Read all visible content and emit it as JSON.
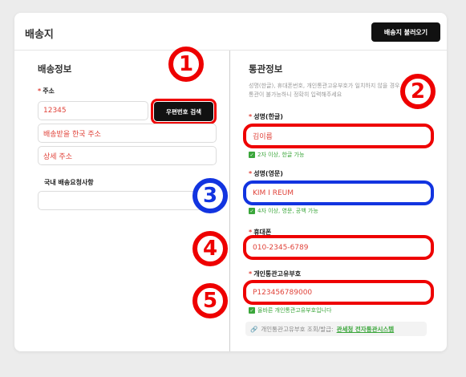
{
  "header": {
    "title": "배송지",
    "load_button": "배송지 불러오기"
  },
  "shipping": {
    "section_title": "배송정보",
    "address_label": "주소",
    "postcode_value": "12345",
    "search_button": "우편번호 검색",
    "address_value": "배송받을 한국 주소",
    "detail_value": "상세 주소",
    "request_label": "국내 배송요청사항",
    "request_value": ""
  },
  "customs": {
    "section_title": "통관정보",
    "description_line1": "성명(한글), 휴대폰번호, 개인통관고유부호가 일치하지 않을 경우",
    "description_line2": "통관이 불가능하니 정확히 입력해주세요",
    "name_kr_label": "성명(한글)",
    "name_kr_value": "김이름",
    "name_kr_hint": "2자 이상, 한글 가능",
    "name_en_label": "성명(영문)",
    "name_en_value": "KIM I REUM",
    "name_en_hint": "4자 이상, 영문, 공백 가능",
    "phone_label": "휴대폰",
    "phone_value": "010-2345-6789",
    "customs_code_label": "개인통관고유부호",
    "customs_code_value": "P123456789000",
    "customs_code_hint": "올바른 개인통관고유부호입니다",
    "lookup_prefix": "개인통관고유부호 조회/발급:",
    "lookup_link": "관세청 전자통관시스템"
  },
  "annotations": {
    "badge1": "1",
    "badge2": "2",
    "badge3": "3",
    "badge4": "4",
    "badge5": "5"
  },
  "colors": {
    "annotation_red": "#e00000",
    "annotation_blue": "#1234e0",
    "valid_green": "#3aa63a"
  }
}
